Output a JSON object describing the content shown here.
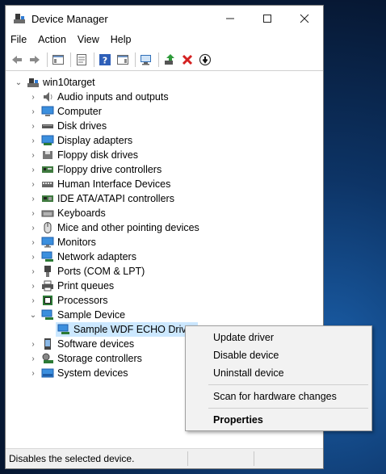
{
  "window": {
    "title": "Device Manager"
  },
  "menu": [
    "File",
    "Action",
    "View",
    "Help"
  ],
  "toolbar": [
    "back-icon",
    "forward-icon",
    "console-tree-icon",
    "properties-icon",
    "help-icon",
    "action-pane-icon",
    "scan-icon",
    "update-driver-icon",
    "uninstall-icon",
    "disable-icon"
  ],
  "tree": {
    "root": "win10target",
    "items": [
      {
        "label": "Audio inputs and outputs",
        "icon": "speaker-icon"
      },
      {
        "label": "Computer",
        "icon": "computer-icon"
      },
      {
        "label": "Disk drives",
        "icon": "disk-drive-icon"
      },
      {
        "label": "Display adapters",
        "icon": "display-adapter-icon"
      },
      {
        "label": "Floppy disk drives",
        "icon": "floppy-disk-icon"
      },
      {
        "label": "Floppy drive controllers",
        "icon": "floppy-controller-icon"
      },
      {
        "label": "Human Interface Devices",
        "icon": "hid-icon"
      },
      {
        "label": "IDE ATA/ATAPI controllers",
        "icon": "ide-controller-icon"
      },
      {
        "label": "Keyboards",
        "icon": "keyboard-icon"
      },
      {
        "label": "Mice and other pointing devices",
        "icon": "mouse-icon"
      },
      {
        "label": "Monitors",
        "icon": "monitor-icon"
      },
      {
        "label": "Network adapters",
        "icon": "network-adapter-icon"
      },
      {
        "label": "Ports (COM & LPT)",
        "icon": "port-icon"
      },
      {
        "label": "Print queues",
        "icon": "printer-icon"
      },
      {
        "label": "Processors",
        "icon": "processor-icon"
      },
      {
        "label": "Sample Device",
        "icon": "sample-device-icon"
      },
      {
        "label": "Sample WDF ECHO Driver",
        "icon": "driver-icon"
      },
      {
        "label": "Software devices",
        "icon": "software-device-icon"
      },
      {
        "label": "Storage controllers",
        "icon": "storage-controller-icon"
      },
      {
        "label": "System devices",
        "icon": "system-device-icon"
      }
    ]
  },
  "context_menu": {
    "update": "Update driver",
    "disable": "Disable device",
    "uninstall": "Uninstall device",
    "scan": "Scan for hardware changes",
    "properties": "Properties"
  },
  "status": {
    "text": "Disables the selected device."
  }
}
